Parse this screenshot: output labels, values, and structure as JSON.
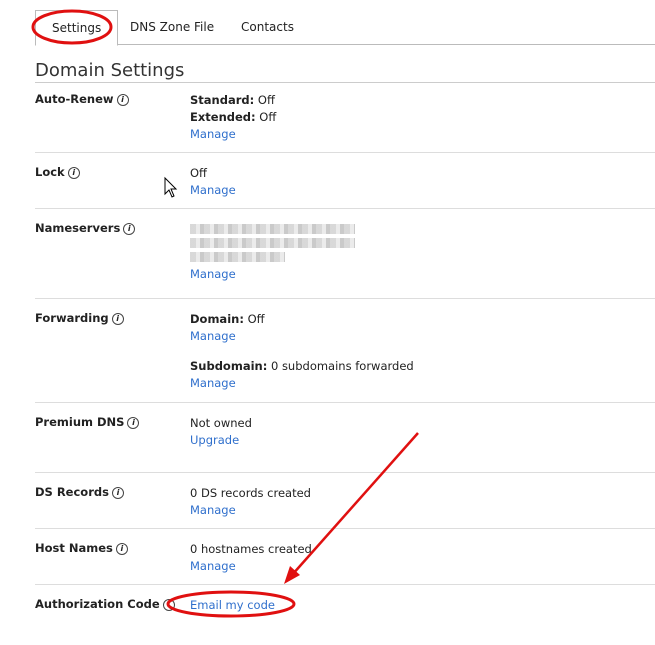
{
  "tabs": [
    "Settings",
    "DNS Zone File",
    "Contacts"
  ],
  "page_title": "Domain Settings",
  "rows": {
    "autorenew": {
      "label": "Auto-Renew",
      "standard_label": "Standard:",
      "standard_value": "Off",
      "extended_label": "Extended:",
      "extended_value": "Off",
      "link": "Manage"
    },
    "lock": {
      "label": "Lock",
      "value": "Off",
      "link": "Manage"
    },
    "nameservers": {
      "label": "Nameservers",
      "link": "Manage"
    },
    "forwarding": {
      "label": "Forwarding",
      "domain_label": "Domain:",
      "domain_value": "Off",
      "link1": "Manage",
      "subdomain_label": "Subdomain:",
      "subdomain_value": "0 subdomains forwarded",
      "link2": "Manage"
    },
    "premium": {
      "label": "Premium DNS",
      "value": "Not owned",
      "link": "Upgrade"
    },
    "ds": {
      "label": "DS Records",
      "value": "0 DS records created",
      "link": "Manage"
    },
    "host": {
      "label": "Host Names",
      "value": "0 hostnames created",
      "link": "Manage"
    },
    "auth": {
      "label": "Authorization Code",
      "link": "Email my code"
    }
  },
  "info_icon": "i",
  "annotation_color": "#e01010"
}
